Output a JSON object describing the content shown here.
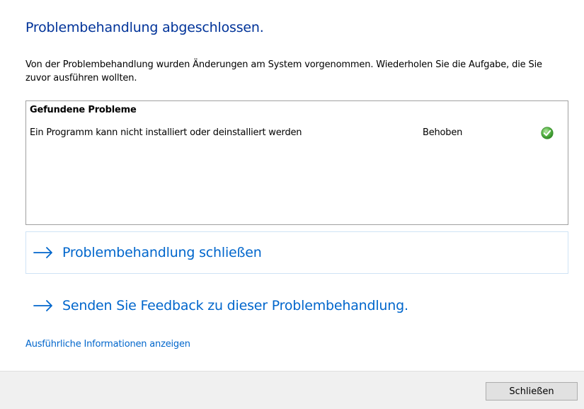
{
  "dialog": {
    "title": "Problembehandlung abgeschlossen.",
    "description": "Von der Problembehandlung wurden Änderungen am System vorgenommen. Wiederholen Sie die Aufgabe, die Sie zuvor ausführen wollten."
  },
  "problems": {
    "header": "Gefundene Probleme",
    "items": [
      {
        "name": "Ein Programm kann nicht installiert oder deinstalliert werden",
        "status": "Behoben",
        "icon": "check-icon"
      }
    ]
  },
  "actions": {
    "close_troubleshooter": "Problembehandlung schließen",
    "send_feedback": "Senden Sie Feedback zu dieser Problembehandlung."
  },
  "details_link": "Ausführliche Informationen anzeigen",
  "footer": {
    "close_button": "Schließen"
  },
  "colors": {
    "title": "#003399",
    "link": "#0066cc",
    "check": "#3fa535",
    "footer_bg": "#f0f0f0"
  }
}
